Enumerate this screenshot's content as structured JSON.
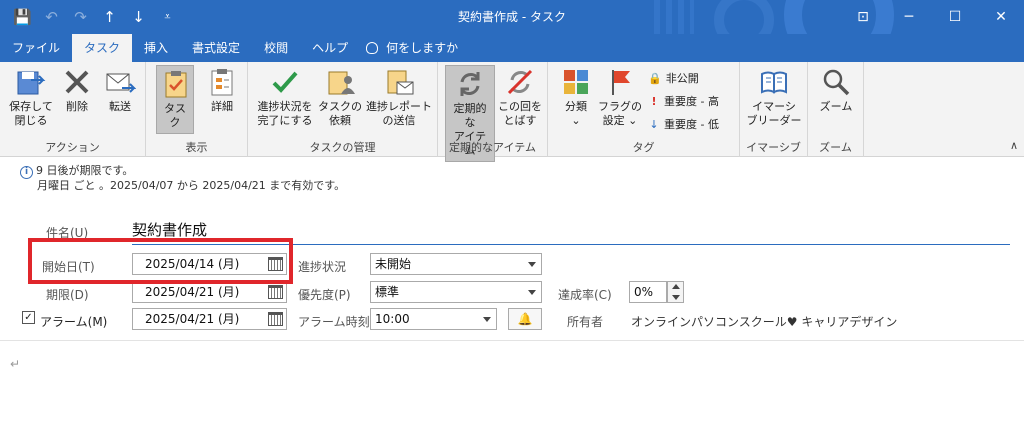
{
  "window": {
    "title": "契約書作成 - タスク"
  },
  "menu": {
    "tabs": [
      "ファイル",
      "タスク",
      "挿入",
      "書式設定",
      "校閲",
      "ヘルプ"
    ],
    "search_label": "何をしますか"
  },
  "ribbon": {
    "save_close": [
      "保存して",
      "閉じる"
    ],
    "delete": "削除",
    "forward": "転送",
    "group_action": "アクション",
    "task": "タスク",
    "details": "詳細",
    "group_view": "表示",
    "mark_complete": [
      "進捗状況を",
      "完了にする"
    ],
    "assign": [
      "タスクの",
      "依頼"
    ],
    "send_report": [
      "進捗レポート",
      "の送信"
    ],
    "group_manage": "タスクの管理",
    "recurrence": [
      "定期的な",
      "アイテム"
    ],
    "skip": [
      "この回を",
      "とばす"
    ],
    "group_recur": "定期的なアイテム",
    "categorize": [
      "分類",
      "⌄"
    ],
    "follow_up": [
      "フラグの",
      "設定 ⌄"
    ],
    "private": "非公開",
    "high_importance": "重要度 - 高",
    "low_importance": "重要度 - 低",
    "group_tags": "タグ",
    "immersive": [
      "イマーシ",
      "ブリーダー"
    ],
    "group_immersive": "イマーシブ",
    "zoom": "ズーム",
    "group_zoom": "ズーム"
  },
  "info": {
    "line1": "9 日後が期限です。",
    "line2": "月曜日 ごと 。2025/04/07 から 2025/04/21 まで有効です。"
  },
  "form": {
    "subject_label": "件名(U)",
    "subject_value": "契約書作成",
    "start_label": "開始日(T)",
    "start_value": "2025/04/14 (月)",
    "due_label": "期限(D)",
    "due_value": "2025/04/21 (月)",
    "reminder_label": "アラーム(M)",
    "reminder_date": "2025/04/21 (月)",
    "status_label": "進捗状況",
    "status_value": "未開始",
    "priority_label": "優先度(P)",
    "priority_value": "標準",
    "reminder_time_label": "アラーム時刻",
    "reminder_time_value": "10:00",
    "percent_label": "達成率(C)",
    "percent_value": "0%",
    "owner_label": "所有者",
    "owner_value": "オンラインパソコンスクール♥ キャリアデザイン"
  }
}
